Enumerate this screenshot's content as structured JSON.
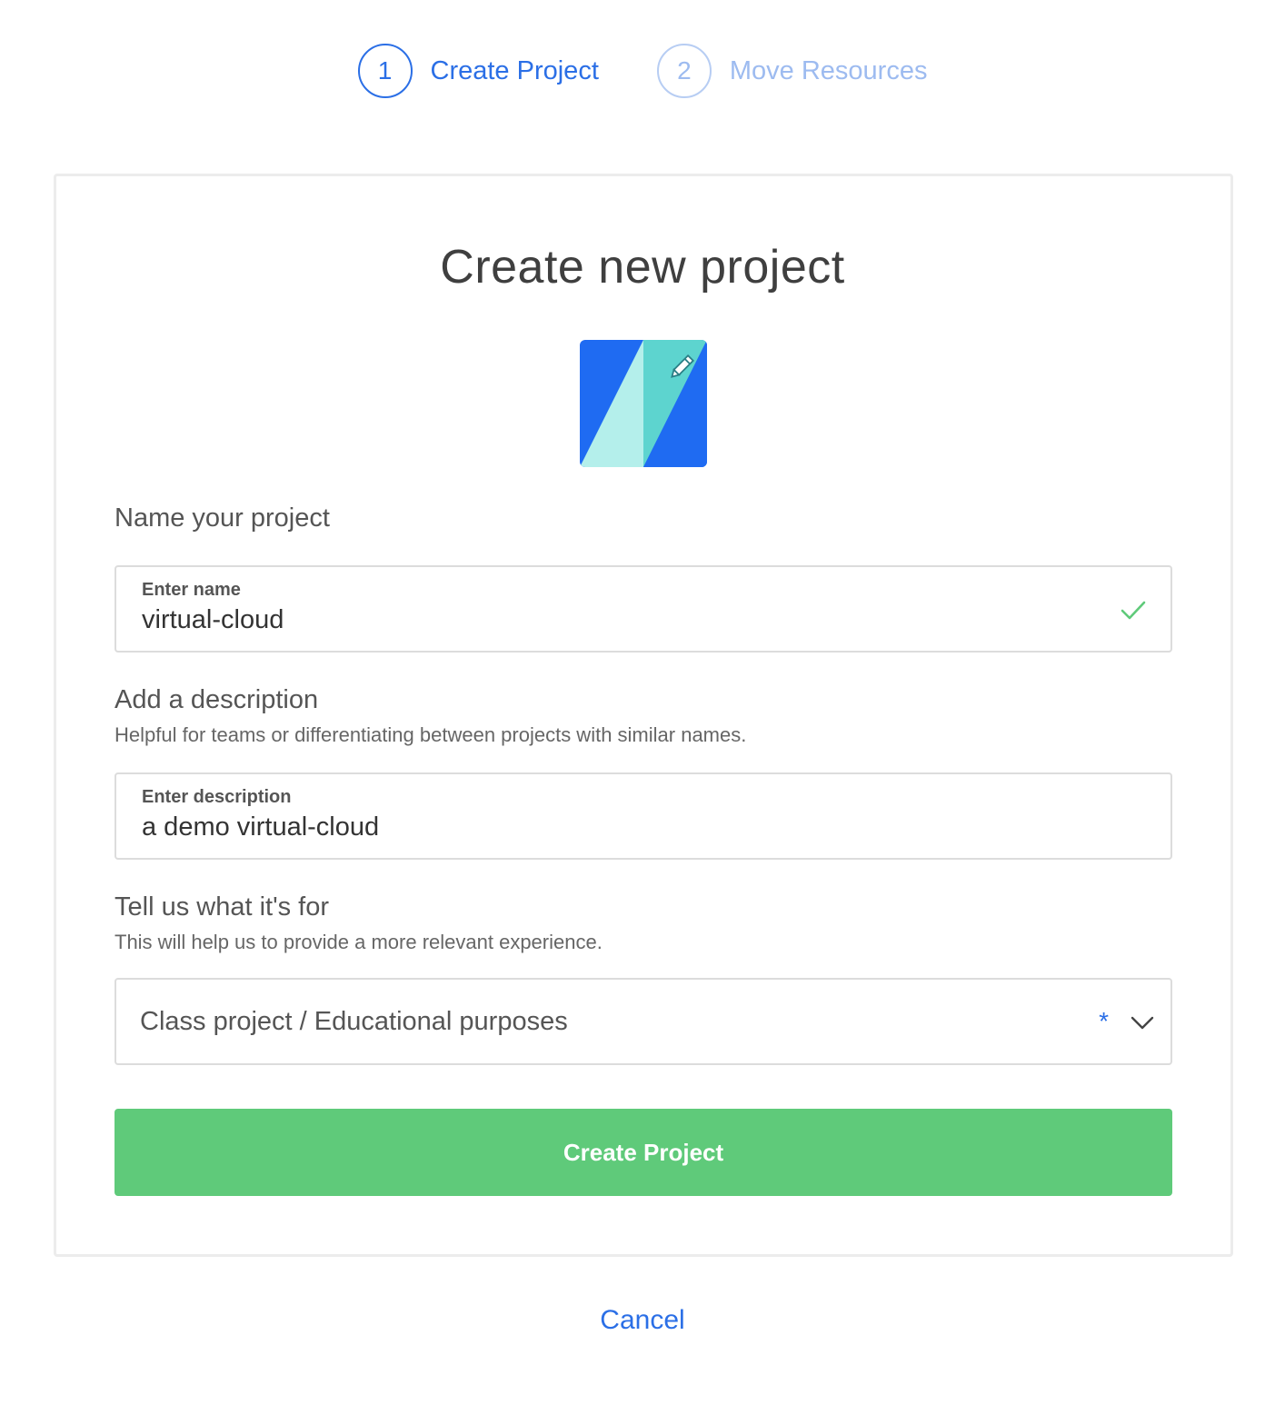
{
  "stepper": {
    "steps": [
      {
        "number": "1",
        "label": "Create Project",
        "state": "active"
      },
      {
        "number": "2",
        "label": "Move Resources",
        "state": "inactive"
      }
    ]
  },
  "card": {
    "title": "Create new project",
    "icon": {
      "name": "project-avatar-edit-icon",
      "colors": [
        "#1f6bf2",
        "#b4efeb",
        "#5dd4cf"
      ]
    },
    "name_section": {
      "title": "Name your project",
      "field_label": "Enter name",
      "field_value": "virtual-cloud",
      "valid_icon": "check-icon"
    },
    "description_section": {
      "title": "Add a description",
      "subtitle": "Helpful for teams or differentiating between projects with similar names.",
      "field_label": "Enter description",
      "field_value": "a demo virtual-cloud"
    },
    "purpose_section": {
      "title": "Tell us what it's for",
      "subtitle": "This will help us to provide a more relevant experience.",
      "selected_value": "Class project / Educational purposes",
      "required_marker": "*"
    },
    "submit_label": "Create Project"
  },
  "cancel_label": "Cancel",
  "colors": {
    "accent": "#2b6fe6",
    "success": "#5fca7a"
  }
}
